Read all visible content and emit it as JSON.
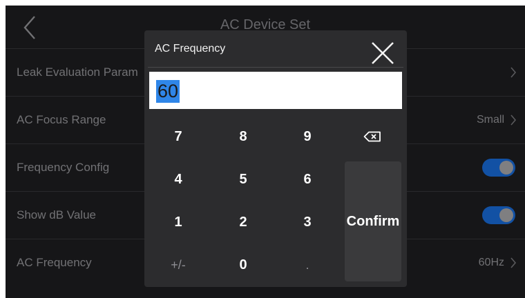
{
  "screen": {
    "title": "AC Device Set",
    "back_icon": "chevron-left-icon"
  },
  "rows": [
    {
      "label": "Leak Evaluation Param",
      "value": "",
      "control": "chevron"
    },
    {
      "label": "AC Focus Range",
      "value": "Small",
      "control": "chevron"
    },
    {
      "label": "Frequency Config",
      "value": "",
      "control": "toggle",
      "toggle_on": true
    },
    {
      "label": "Show dB Value",
      "value": "",
      "control": "toggle",
      "toggle_on": true
    },
    {
      "label": "AC Frequency",
      "value": "60Hz",
      "control": "chevron"
    }
  ],
  "dialog": {
    "title": "AC Frequency",
    "close_icon": "close-icon",
    "input_value": "60",
    "keys": {
      "row1": [
        "7",
        "8",
        "9"
      ],
      "row2": [
        "4",
        "5",
        "6"
      ],
      "row3": [
        "1",
        "2",
        "3"
      ],
      "row4": [
        "+/-",
        "0",
        "."
      ]
    },
    "backspace_icon": "backspace-icon",
    "confirm_label": "Confirm"
  },
  "colors": {
    "background": "#1c1c1e",
    "dialog": "#2c2c2e",
    "accent": "#1763c8",
    "selection": "#2f86e8"
  }
}
